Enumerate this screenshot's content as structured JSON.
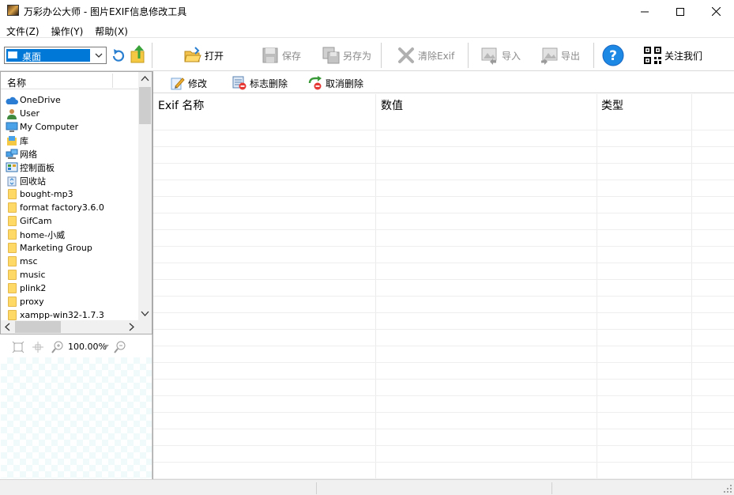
{
  "window": {
    "title": "万彩办公大师 - 图片EXIF信息修改工具",
    "minimize_label": "minimize",
    "maximize_label": "maximize",
    "close_label": "close"
  },
  "menu": [
    {
      "label": "文件(Z)"
    },
    {
      "label": "操作(Y)"
    },
    {
      "label": "帮助(X)"
    }
  ],
  "location": {
    "selected": "桌面"
  },
  "toolbar": {
    "open": "打开",
    "save": "保存",
    "save_as": "另存为",
    "clear_exif": "清除Exif",
    "import": "导入",
    "export": "导出",
    "follow": "关注我们"
  },
  "tree": {
    "header": "名称",
    "items": [
      {
        "label": "OneDrive",
        "icon": "cloud-icon"
      },
      {
        "label": "User",
        "icon": "user-icon"
      },
      {
        "label": "My Computer",
        "icon": "computer-icon"
      },
      {
        "label": "库",
        "icon": "library-icon"
      },
      {
        "label": "网络",
        "icon": "network-icon"
      },
      {
        "label": "控制面板",
        "icon": "control-panel-icon"
      },
      {
        "label": "回收站",
        "icon": "recycle-bin-icon"
      },
      {
        "label": "bought-mp3",
        "icon": "folder-icon"
      },
      {
        "label": "format factory3.6.0",
        "icon": "folder-icon"
      },
      {
        "label": "GifCam",
        "icon": "folder-icon"
      },
      {
        "label": "home-小威",
        "icon": "folder-icon"
      },
      {
        "label": "Marketing Group",
        "icon": "folder-icon"
      },
      {
        "label": "msc",
        "icon": "folder-icon"
      },
      {
        "label": "music",
        "icon": "folder-icon"
      },
      {
        "label": "plink2",
        "icon": "folder-icon"
      },
      {
        "label": "proxy",
        "icon": "folder-icon"
      },
      {
        "label": "xampp-win32-1.7.3",
        "icon": "folder-icon"
      }
    ]
  },
  "zoom": {
    "value": "100.00%"
  },
  "subtoolbar": {
    "edit": "修改",
    "mark_delete": "标志删除",
    "cancel_delete": "取消删除"
  },
  "table": {
    "columns": [
      "Exif 名称",
      "数值",
      "类型"
    ]
  },
  "colors": {
    "accent": "#0078d7",
    "help_blue": "#1e88e5"
  }
}
